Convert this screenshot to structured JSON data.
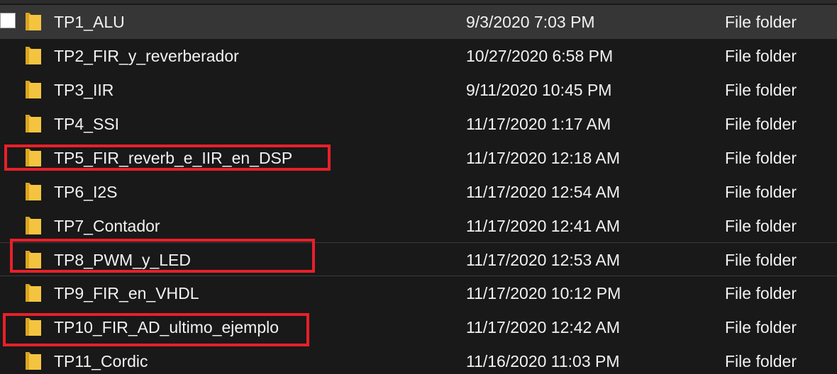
{
  "file_list": {
    "rows": [
      {
        "name": "TP1_ALU",
        "date_modified": "9/3/2020 7:03 PM",
        "type": "File folder",
        "selected": true,
        "icon": "folder-icon"
      },
      {
        "name": "TP2_FIR_y_reverberador",
        "date_modified": "10/27/2020 6:58 PM",
        "type": "File folder",
        "icon": "folder-icon"
      },
      {
        "name": "TP3_IIR",
        "date_modified": "9/11/2020 10:45 PM",
        "type": "File folder",
        "icon": "folder-icon"
      },
      {
        "name": "TP4_SSI",
        "date_modified": "11/17/2020 1:17 AM",
        "type": "File folder",
        "icon": "folder-icon"
      },
      {
        "name": "TP5_FIR_reverb_e_IIR_en_DSP",
        "date_modified": "11/17/2020 12:18 AM",
        "type": "File folder",
        "highlighted": true,
        "icon": "folder-icon"
      },
      {
        "name": "TP6_I2S",
        "date_modified": "11/17/2020 12:54 AM",
        "type": "File folder",
        "icon": "folder-icon"
      },
      {
        "name": "TP7_Contador",
        "date_modified": "11/17/2020 12:41 AM",
        "type": "File folder",
        "icon": "folder-icon"
      },
      {
        "name": "TP8_PWM_y_LED",
        "date_modified": "11/17/2020 12:53 AM",
        "type": "File folder",
        "highlighted": true,
        "icon": "folder-icon"
      },
      {
        "name": "TP9_FIR_en_VHDL",
        "date_modified": "11/17/2020 10:12 PM",
        "type": "File folder",
        "icon": "folder-icon"
      },
      {
        "name": "TP10_FIR_AD_ultimo_ejemplo",
        "date_modified": "11/17/2020 12:42 AM",
        "type": "File folder",
        "highlighted": true,
        "icon": "folder-icon"
      },
      {
        "name": "TP11_Cordic",
        "date_modified": "11/16/2020 11:03 PM",
        "type": "File folder",
        "icon": "folder-icon"
      }
    ]
  },
  "colors": {
    "background": "#191919",
    "text": "#f2f2f2",
    "folder": "#f4c441",
    "highlight": "#e8202a",
    "selected_row": "#363636"
  }
}
